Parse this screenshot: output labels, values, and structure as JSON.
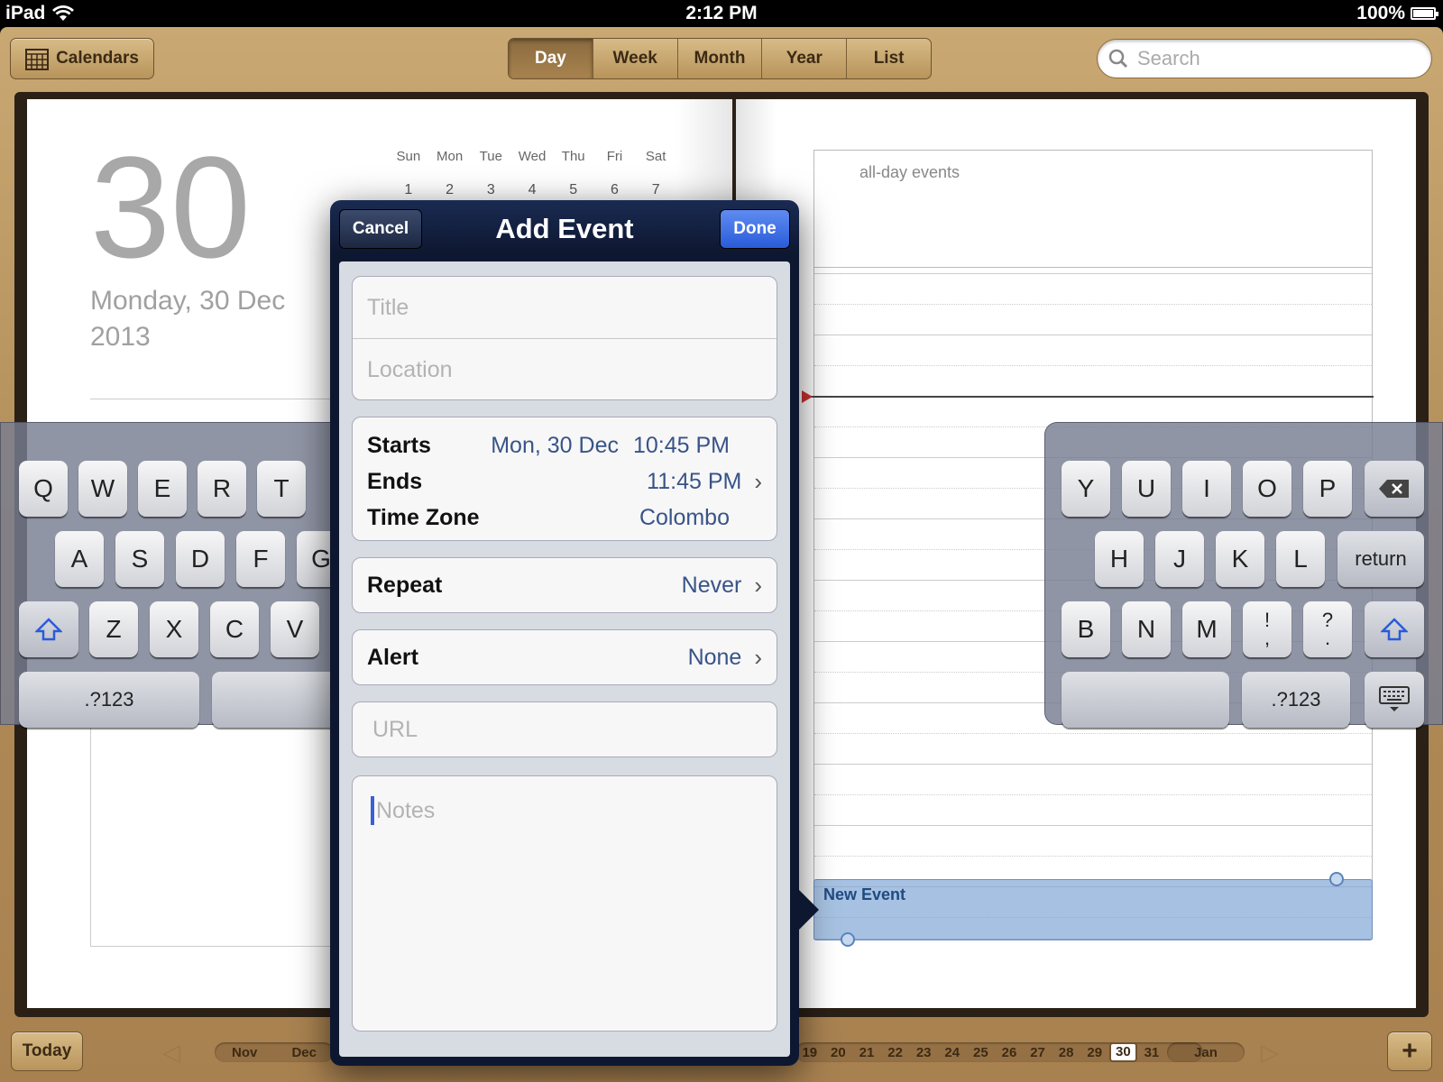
{
  "status": {
    "device": "iPad",
    "time": "2:12 PM",
    "battery": "100%"
  },
  "toolbar": {
    "calendars_label": "Calendars",
    "views": [
      {
        "label": "Day",
        "active": true
      },
      {
        "label": "Week",
        "active": false
      },
      {
        "label": "Month",
        "active": false
      },
      {
        "label": "Year",
        "active": false
      },
      {
        "label": "List",
        "active": false
      }
    ],
    "search_placeholder": "Search"
  },
  "left_page": {
    "day_number": "30",
    "date_long": "Monday, 30 Dec 2013",
    "mini_cal_weekdays": [
      "Sun",
      "Mon",
      "Tue",
      "Wed",
      "Thu",
      "Fri",
      "Sat"
    ],
    "mini_cal_row1": [
      "1",
      "2",
      "3",
      "4",
      "5",
      "6",
      "7"
    ]
  },
  "day_view": {
    "all_day_label": "all-day events",
    "new_event_label": "New Event"
  },
  "popover": {
    "title": "Add Event",
    "cancel_label": "Cancel",
    "done_label": "Done",
    "title_placeholder": "Title",
    "location_placeholder": "Location",
    "starts_label": "Starts",
    "starts_date": "Mon, 30 Dec",
    "starts_time": "10:45 PM",
    "ends_label": "Ends",
    "ends_time": "11:45 PM",
    "timezone_label": "Time Zone",
    "timezone_value": "Colombo",
    "repeat_label": "Repeat",
    "repeat_value": "Never",
    "alert_label": "Alert",
    "alert_value": "None",
    "url_placeholder": "URL",
    "notes_placeholder": "Notes"
  },
  "keyboard": {
    "left_row1": [
      "Q",
      "W",
      "E",
      "R",
      "T"
    ],
    "left_row2": [
      "A",
      "S",
      "D",
      "F",
      "G"
    ],
    "left_row3": [
      "Z",
      "X",
      "C",
      "V"
    ],
    "left_numbers": ".?123",
    "right_row1": [
      "Y",
      "U",
      "I",
      "O",
      "P"
    ],
    "right_row2": [
      "H",
      "J",
      "K",
      "L"
    ],
    "right_return": "return",
    "right_row3": [
      "B",
      "N",
      "M"
    ],
    "excl_top": "!",
    "excl_bottom": ",",
    "quest_top": "?",
    "quest_bottom": ".",
    "right_numbers": ".?123"
  },
  "bottom": {
    "today_label": "Today",
    "months_left": [
      "Nov",
      "Dec"
    ],
    "dates": [
      "19",
      "20",
      "21",
      "22",
      "23",
      "24",
      "25",
      "26",
      "27",
      "28",
      "29",
      "30",
      "31"
    ],
    "selected_date": "30",
    "month_right": "Jan",
    "add_label": "+"
  }
}
